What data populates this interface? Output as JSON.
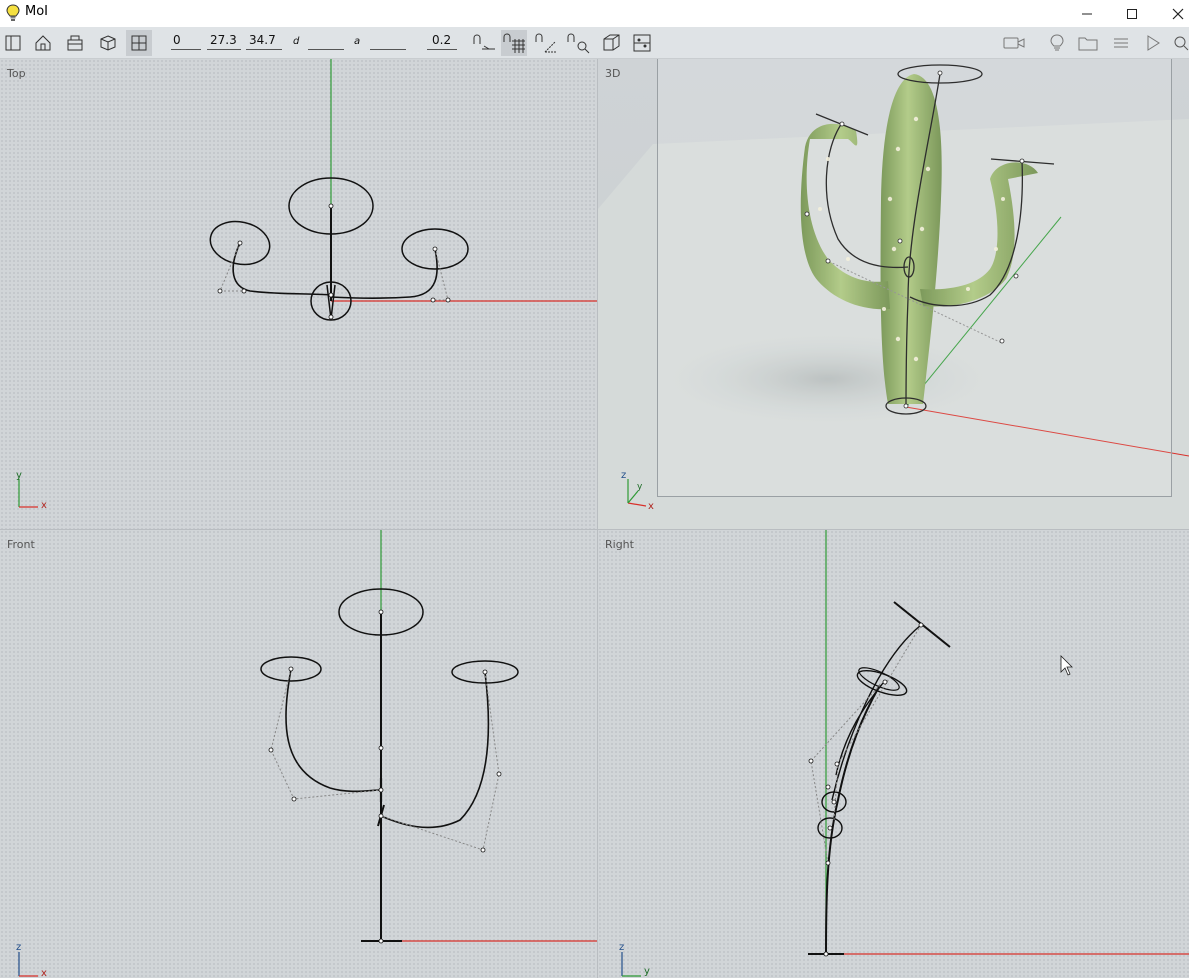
{
  "window": {
    "title": "MoI"
  },
  "toolbar": {
    "coords": {
      "x": "0",
      "y": "27.3",
      "z": "34.7"
    },
    "distance_label": "d",
    "angle_label": "a",
    "grid_snap_value": "0.2"
  },
  "viewports": {
    "top": {
      "label": "Top",
      "axis_v": "y",
      "axis_h": "x"
    },
    "three_d": {
      "label": "3D",
      "axis_v": "z",
      "axis_h": "x",
      "axis_y": "y"
    },
    "front": {
      "label": "Front",
      "axis_v": "z",
      "axis_h": "x"
    },
    "right": {
      "label": "Right",
      "axis_v": "z",
      "axis_h": "y"
    }
  },
  "colors": {
    "x_axis": "#d8302a",
    "y_axis": "#2e9a35",
    "curve": "#111111",
    "cactus": "#8aaa5a"
  }
}
